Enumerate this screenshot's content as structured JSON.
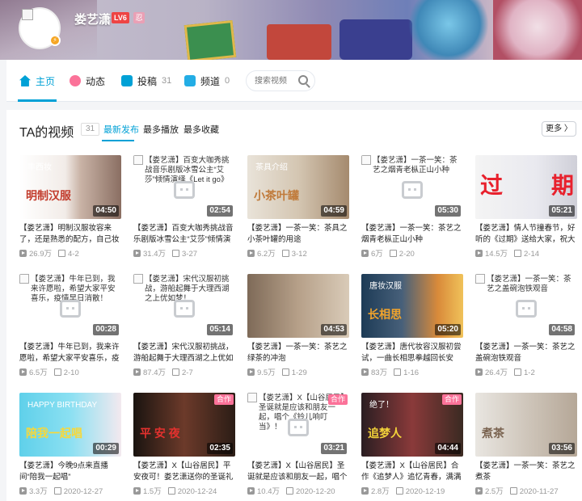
{
  "user": {
    "name": "娄艺潇",
    "level": "LV6",
    "level2": "忍"
  },
  "nav": {
    "items": [
      {
        "label": "主页",
        "count": ""
      },
      {
        "label": "动态",
        "count": ""
      },
      {
        "label": "投稿",
        "count": "31"
      },
      {
        "label": "频道",
        "count": "0"
      }
    ],
    "search_placeholder": "搜索视频"
  },
  "section": {
    "title": "TA的视频",
    "count": "31",
    "tabs": [
      "最新发布",
      "最多播放",
      "最多收藏"
    ],
    "more": "更多 〉"
  },
  "videos": [
    {
      "title": "【娄艺潇】明制汉服妆容来了，还是熟悉的配方，自己妆",
      "duration": "04:50",
      "views": "26.9万",
      "date": "4-2",
      "thumb_text": "明制汉服",
      "thumb_text2": "丰西妆",
      "coop": ""
    },
    {
      "title": "【娄艺潇】百变大咖秀挑战音乐剧版冰雪公主“艾莎”倾情演绎《Let it go》",
      "duration": "02:54",
      "views": "31.4万",
      "date": "3-27",
      "thumb_text": "【娄艺潇】百变大咖秀挑战音乐剧版冰雪公主“艾莎”倾情演绎《Let it go》",
      "thumb_text2": "",
      "coop": ""
    },
    {
      "title": "【娄艺潇】一茶一笑：茶具之小茶叶罐的用途",
      "duration": "04:59",
      "views": "6.2万",
      "date": "3-12",
      "thumb_text": "小茶叶罐",
      "thumb_text2": "茶具介绍",
      "coop": ""
    },
    {
      "title": "【娄艺潇】一茶一笑：茶艺之烟青老枞正山小种",
      "duration": "05:30",
      "views": "6万",
      "date": "2-20",
      "thumb_text": "【娄艺潇】一茶一笑：茶艺之烟青老枞正山小种",
      "thumb_text2": "",
      "coop": ""
    },
    {
      "title": "【娄艺潇】情人节撞春节，好听的《过期》送给大家，祝大",
      "duration": "05:21",
      "views": "14.5万",
      "date": "2-14",
      "thumb_text": "过",
      "thumb_text2": "期",
      "coop": ""
    },
    {
      "title": "【娄艺潇】牛年已到，我来许愿啦，希望大家平安喜乐，疫",
      "duration": "00:28",
      "views": "6.5万",
      "date": "2-10",
      "thumb_text": "【娄艺潇】牛年已到，我来许愿啦，希望大家平安喜乐，疫情早日消散！",
      "thumb_text2": "",
      "coop": ""
    },
    {
      "title": "【娄艺潇】宋代汉服初挑战，游船起舞于大理西湖之上优如",
      "duration": "05:14",
      "views": "87.4万",
      "date": "2-7",
      "thumb_text": "【娄艺潇】宋代汉服初挑战，游船起舞于大理西湖之上优如梦！",
      "thumb_text2": "",
      "coop": ""
    },
    {
      "title": "【娄艺潇】一茶一笑：茶艺之绿茶的冲泡",
      "duration": "04:53",
      "views": "9.5万",
      "date": "1-29",
      "thumb_text": "",
      "thumb_text2": "",
      "coop": ""
    },
    {
      "title": "【娄艺潇】唐代妆容汉服初尝试，一曲长相思拳越回长安",
      "duration": "05:20",
      "views": "83万",
      "date": "1-16",
      "thumb_text": "长相思",
      "thumb_text2": "唐妆汉服",
      "coop": ""
    },
    {
      "title": "【娄艺潇】一茶一笑：茶艺之盖碗泡铁观音",
      "duration": "04:58",
      "views": "26.4万",
      "date": "1-2",
      "thumb_text": "【娄艺潇】一茶一笑：茶艺之盖碗泡铁观音",
      "thumb_text2": "",
      "coop": ""
    },
    {
      "title": "【娄艺潇】今晚9点来直播间“陪我一起唱”",
      "duration": "00:29",
      "views": "3.3万",
      "date": "2020-12-27",
      "thumb_text": "陪我一起唱",
      "thumb_text2": "HAPPY BIRTHDAY",
      "coop": ""
    },
    {
      "title": "【娄艺潇】X【山谷居民】平安夜可！娄艺潇送你的圣诞礼物到",
      "duration": "02:35",
      "views": "1.5万",
      "date": "2020-12-24",
      "thumb_text": "平 安 夜",
      "thumb_text2": "",
      "coop": "合作"
    },
    {
      "title": "【娄艺潇】X【山谷居民】圣诞就是应该和朋友一起，唱个",
      "duration": "03:21",
      "views": "10.4万",
      "date": "2020-12-20",
      "thumb_text": "【娄艺潇】X【山谷居民】圣诞就是应该和朋友一起，唱个《铃儿响叮当》！",
      "thumb_text2": "",
      "coop": "合作"
    },
    {
      "title": "【娄艺潇】X【山谷居民】合作《追梦人》追忆青春，满满",
      "duration": "04:44",
      "views": "2.8万",
      "date": "2020-12-19",
      "thumb_text": "追梦人",
      "thumb_text2": "绝了！",
      "coop": "合作"
    },
    {
      "title": "【娄艺潇】一茶一笑：茶艺之煮茶",
      "duration": "03:56",
      "views": "2.5万",
      "date": "2020-11-27",
      "thumb_text": "煮茶",
      "thumb_text2": "",
      "coop": ""
    }
  ]
}
